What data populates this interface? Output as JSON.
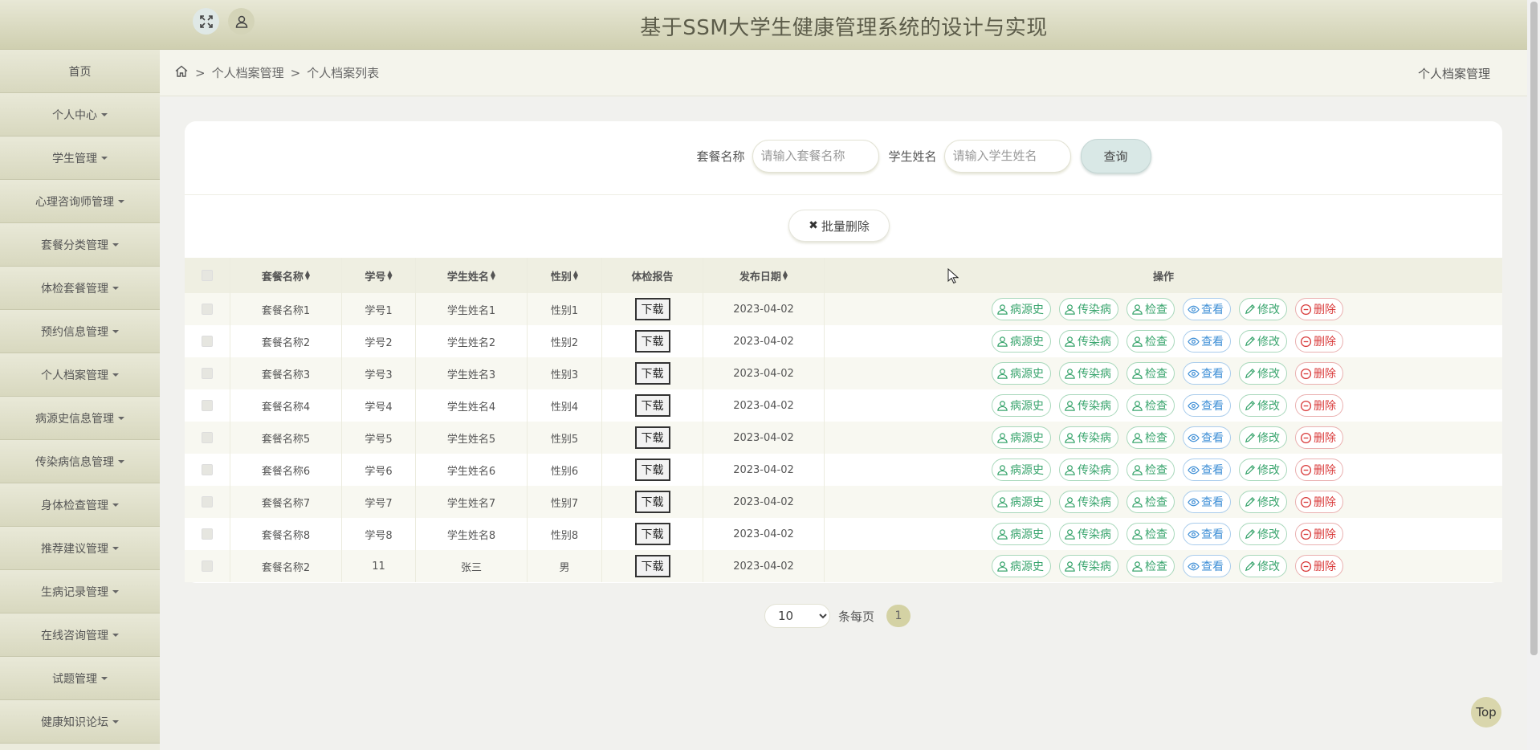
{
  "app": {
    "title": "基于SSM大学生健康管理系统的设计与实现"
  },
  "topbar": {
    "icons": [
      "expand-icon",
      "user-icon"
    ]
  },
  "sidebar": {
    "items": [
      {
        "label": "首页",
        "has_caret": false
      },
      {
        "label": "个人中心",
        "has_caret": true
      },
      {
        "label": "学生管理",
        "has_caret": true
      },
      {
        "label": "心理咨询师管理",
        "has_caret": true
      },
      {
        "label": "套餐分类管理",
        "has_caret": true
      },
      {
        "label": "体检套餐管理",
        "has_caret": true
      },
      {
        "label": "预约信息管理",
        "has_caret": true
      },
      {
        "label": "个人档案管理",
        "has_caret": true
      },
      {
        "label": "病源史信息管理",
        "has_caret": true
      },
      {
        "label": "传染病信息管理",
        "has_caret": true
      },
      {
        "label": "身体检查管理",
        "has_caret": true
      },
      {
        "label": "推荐建议管理",
        "has_caret": true
      },
      {
        "label": "生病记录管理",
        "has_caret": true
      },
      {
        "label": "在线咨询管理",
        "has_caret": true
      },
      {
        "label": "试题管理",
        "has_caret": true
      },
      {
        "label": "健康知识论坛",
        "has_caret": true
      }
    ]
  },
  "breadcrumb": {
    "sep": ">",
    "level1": "个人档案管理",
    "level2": "个人档案列表",
    "right_title": "个人档案管理"
  },
  "search": {
    "package_label": "套餐名称",
    "package_placeholder": "请输入套餐名称",
    "student_label": "学生姓名",
    "student_placeholder": "请输入学生姓名",
    "query_label": "查询"
  },
  "batch_delete_label": "批量删除",
  "table": {
    "headers": {
      "package": "套餐名称",
      "student_id": "学号",
      "student_name": "学生姓名",
      "gender": "性别",
      "report": "体检报告",
      "date": "发布日期",
      "ops": "操作"
    },
    "download_label": "下载",
    "op_labels": [
      "病源史",
      "传染病",
      "检查",
      "查看",
      "修改",
      "删除"
    ],
    "rows": [
      {
        "package": "套餐名称1",
        "student_id": "学号1",
        "student_name": "学生姓名1",
        "gender": "性别1",
        "date": "2023-04-02"
      },
      {
        "package": "套餐名称2",
        "student_id": "学号2",
        "student_name": "学生姓名2",
        "gender": "性别2",
        "date": "2023-04-02"
      },
      {
        "package": "套餐名称3",
        "student_id": "学号3",
        "student_name": "学生姓名3",
        "gender": "性别3",
        "date": "2023-04-02"
      },
      {
        "package": "套餐名称4",
        "student_id": "学号4",
        "student_name": "学生姓名4",
        "gender": "性别4",
        "date": "2023-04-02"
      },
      {
        "package": "套餐名称5",
        "student_id": "学号5",
        "student_name": "学生姓名5",
        "gender": "性别5",
        "date": "2023-04-02"
      },
      {
        "package": "套餐名称6",
        "student_id": "学号6",
        "student_name": "学生姓名6",
        "gender": "性别6",
        "date": "2023-04-02"
      },
      {
        "package": "套餐名称7",
        "student_id": "学号7",
        "student_name": "学生姓名7",
        "gender": "性别7",
        "date": "2023-04-02"
      },
      {
        "package": "套餐名称8",
        "student_id": "学号8",
        "student_name": "学生姓名8",
        "gender": "性别8",
        "date": "2023-04-02"
      },
      {
        "package": "套餐名称2",
        "student_id": "11",
        "student_name": "张三",
        "gender": "男",
        "date": "2023-04-02"
      }
    ]
  },
  "pager": {
    "page_size": "10",
    "per_page_label": "条每页",
    "current_page": "1"
  },
  "top_button_label": "Top",
  "colors": {
    "accent": "#d4d2a4",
    "green": "#3aa56e",
    "blue": "#3f8fd6",
    "red": "#d93b3b"
  }
}
